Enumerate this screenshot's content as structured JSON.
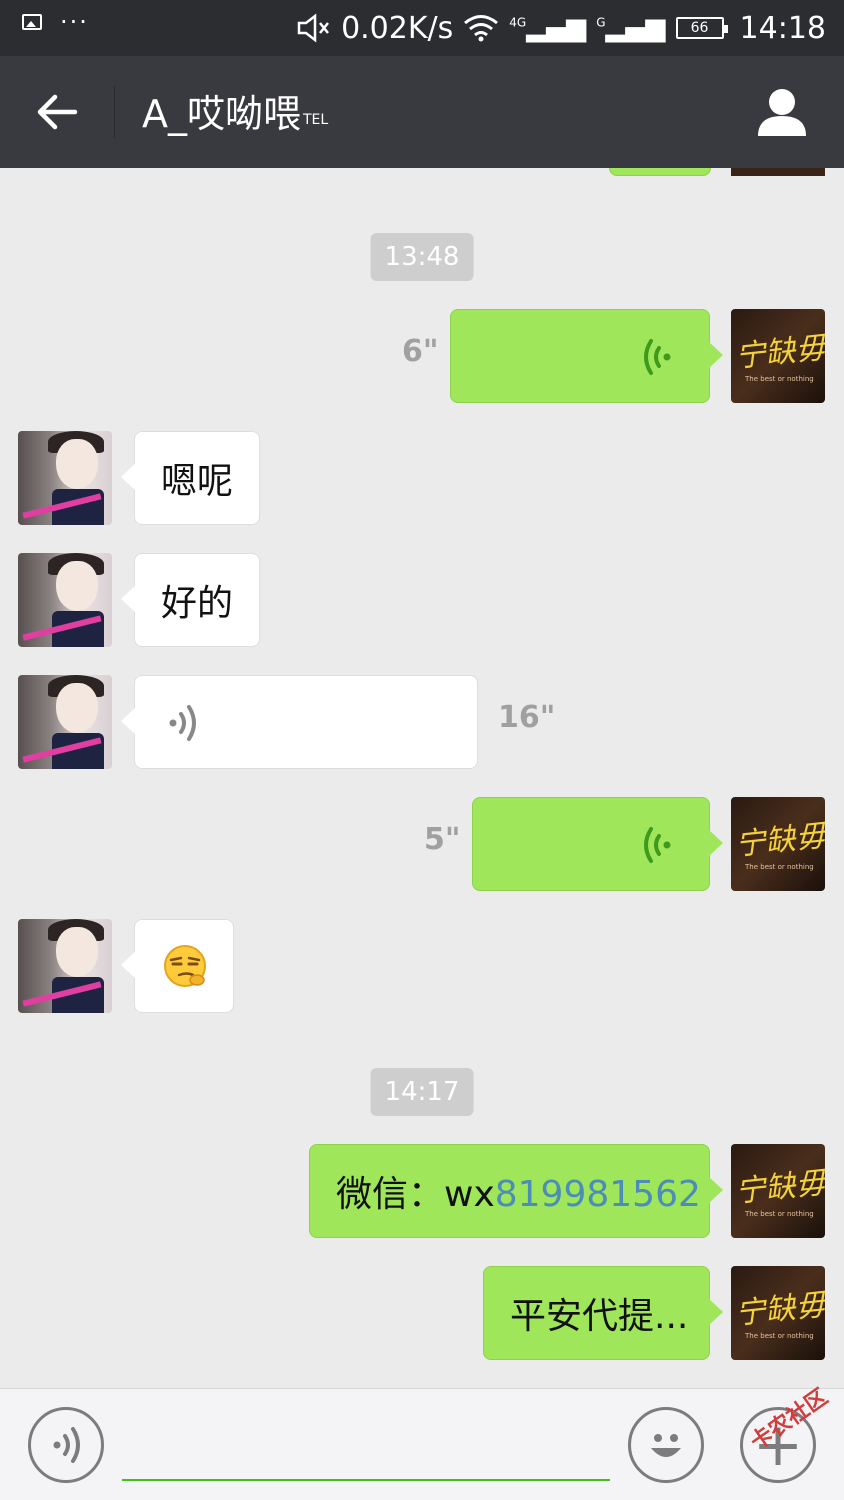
{
  "status_bar": {
    "speed": "0.02K/s",
    "network_1": "4G",
    "network_2": "G",
    "battery": "66",
    "time": "14:18"
  },
  "header": {
    "title": "A_哎呦喂",
    "title_sup": "TEL"
  },
  "messages": [
    {
      "type": "time",
      "text": "13:48"
    },
    {
      "from": "me",
      "kind": "voice",
      "duration": "6\""
    },
    {
      "from": "her",
      "kind": "text",
      "text": "嗯呢"
    },
    {
      "from": "her",
      "kind": "text",
      "text": "好的"
    },
    {
      "from": "her",
      "kind": "voice",
      "duration": "16\""
    },
    {
      "from": "me",
      "kind": "voice",
      "duration": "5\""
    },
    {
      "from": "her",
      "kind": "emoji",
      "icon": "smirk-emoji"
    },
    {
      "type": "time",
      "text": "14:17"
    },
    {
      "from": "me",
      "kind": "text",
      "prefix": "微信：wx",
      "link": "819981562"
    },
    {
      "from": "me",
      "kind": "text",
      "text": "平安代提..."
    }
  ],
  "my_avatar": {
    "text": "宁缺毋滥!",
    "sub": "The best or nothing"
  },
  "watermark": "卡农社区",
  "colors": {
    "green_bubble": "#9fe65a",
    "titlebar": "#393a3f",
    "link": "#4b8cb8",
    "input_underline": "#45c01a"
  }
}
